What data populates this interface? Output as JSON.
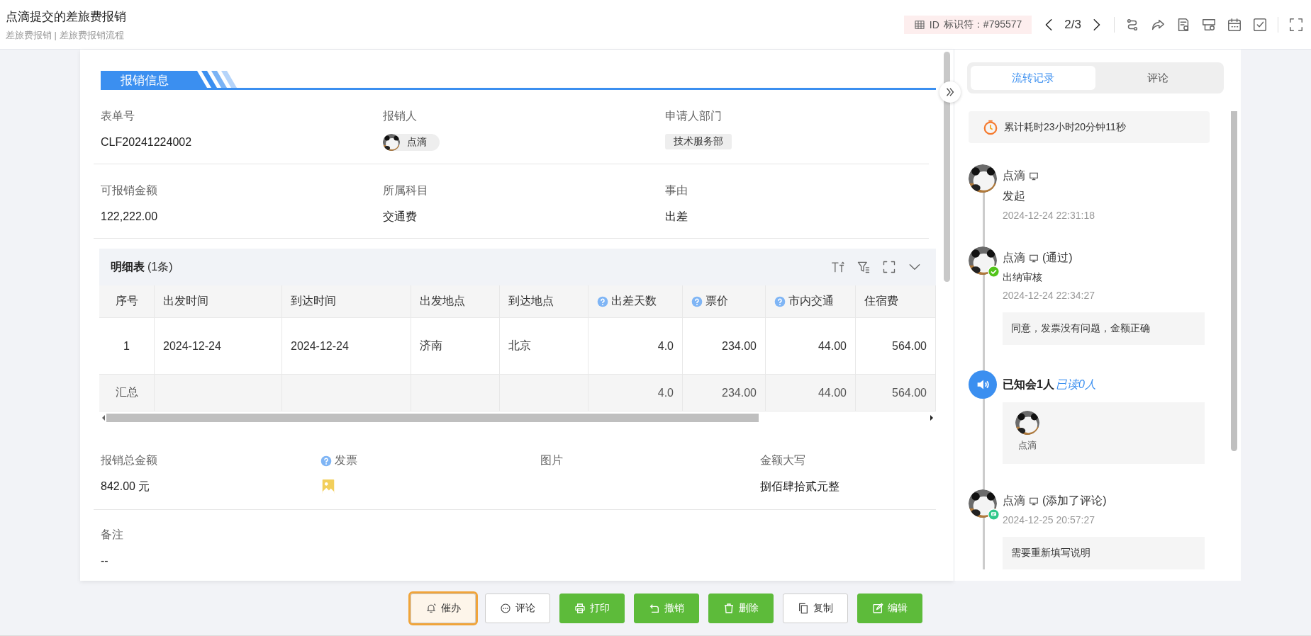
{
  "header": {
    "title": "点滴提交的差旅费报销",
    "breadcrumb": "差旅费报销 | 差旅费报销流程",
    "id_label": "ID",
    "id_value": "标识符：#795577",
    "pager": "2/3"
  },
  "section_title": "报销信息",
  "field_rows": [
    [
      {
        "label": "表单号",
        "kind": "text",
        "value": "CLF20241224002"
      },
      {
        "label": "报销人",
        "kind": "user",
        "value": "点滴"
      },
      {
        "label": "申请人部门",
        "kind": "tag",
        "value": "技术服务部"
      }
    ],
    [
      {
        "label": "可报销金额",
        "kind": "text",
        "value": "122,222.00"
      },
      {
        "label": "所属科目",
        "kind": "text",
        "value": "交通费"
      },
      {
        "label": "事由",
        "kind": "text",
        "value": "出差"
      }
    ]
  ],
  "detail_table": {
    "title": "明细表",
    "count": "(1条)",
    "columns": [
      {
        "label": "序号",
        "help": false,
        "kind": "index",
        "total": "汇总"
      },
      {
        "label": "出发时间",
        "help": false,
        "kind": "text"
      },
      {
        "label": "到达时间",
        "help": false,
        "kind": "text"
      },
      {
        "label": "出发地点",
        "help": false,
        "kind": "text"
      },
      {
        "label": "到达地点",
        "help": false,
        "kind": "text"
      },
      {
        "label": "出差天数",
        "help": true,
        "kind": "number",
        "total": "4.0"
      },
      {
        "label": "票价",
        "help": true,
        "kind": "number",
        "total": "234.00"
      },
      {
        "label": "市内交通",
        "help": true,
        "kind": "number",
        "total": "44.00"
      },
      {
        "label": "住宿费",
        "help": false,
        "kind": "number",
        "total": "564.00"
      }
    ],
    "rows": [
      [
        "1",
        "2024-12-24",
        "2024-12-24",
        "济南",
        "北京",
        "4.0",
        "234.00",
        "44.00",
        "564.00"
      ]
    ]
  },
  "summary_fields": [
    {
      "label": "报销总金额",
      "help": false,
      "kind": "text",
      "value": "842.00 元"
    },
    {
      "label": "发票",
      "help": true,
      "kind": "image"
    },
    {
      "label": "图片",
      "help": false,
      "kind": "empty"
    },
    {
      "label": "金额大写",
      "help": false,
      "kind": "text",
      "value": "捌佰肆拾贰元整"
    }
  ],
  "remark": {
    "label": "备注",
    "value": "--"
  },
  "side_panel": {
    "tabs": [
      {
        "label": "流转记录",
        "selected": true
      },
      {
        "label": "评论",
        "selected": false
      }
    ],
    "duration": "累计耗时23小时20分钟11秒",
    "timeline": [
      {
        "kind": "user",
        "name": "点滴",
        "approved": false,
        "commented": false,
        "step": "发起",
        "time": "2024-12-24 22:31:18"
      },
      {
        "kind": "user",
        "name": "点滴",
        "approved": true,
        "commented": false,
        "action": "(通过)",
        "sub": "出纳审核",
        "time": "2024-12-24 22:34:27",
        "note": "同意，发票没有问题，金额正确"
      },
      {
        "kind": "notify",
        "text": "已知会1人",
        "read": "已读0人",
        "people": [
          {
            "name": "点滴"
          }
        ]
      },
      {
        "kind": "user",
        "name": "点滴",
        "approved": false,
        "commented": true,
        "action": "(添加了评论)",
        "time": "2024-12-25 20:57:27",
        "note": "需要重新填写说明"
      }
    ]
  },
  "buttons": [
    {
      "label": "催办",
      "kind": "outline",
      "focused": true
    },
    {
      "label": "评论",
      "kind": "outline",
      "focused": false
    },
    {
      "label": "打印",
      "kind": "primary",
      "focused": false
    },
    {
      "label": "撤销",
      "kind": "primary",
      "focused": false
    },
    {
      "label": "删除",
      "kind": "primary",
      "focused": false
    },
    {
      "label": "复制",
      "kind": "outline",
      "focused": false
    },
    {
      "label": "编辑",
      "kind": "primary",
      "focused": false
    }
  ]
}
